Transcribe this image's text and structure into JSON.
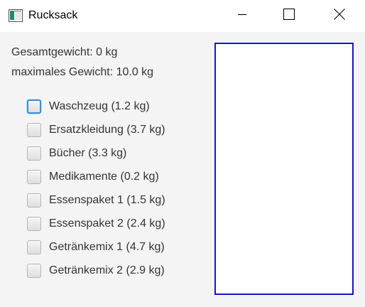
{
  "window": {
    "title": "Rucksack",
    "controls": {
      "minimize": "minimize",
      "maximize": "maximize",
      "close": "close"
    }
  },
  "info": {
    "total_weight": "Gesamtgewicht: 0 kg",
    "max_weight": "maximales Gewicht: 10.0 kg"
  },
  "items": [
    {
      "label": "Waschzeug (1.2 kg)",
      "checked": false,
      "focused": true
    },
    {
      "label": "Ersatzkleidung (3.7 kg)",
      "checked": false,
      "focused": false
    },
    {
      "label": "Bücher (3.3 kg)",
      "checked": false,
      "focused": false
    },
    {
      "label": "Medikamente (0.2 kg)",
      "checked": false,
      "focused": false
    },
    {
      "label": "Essenspaket 1 (1.5 kg)",
      "checked": false,
      "focused": false
    },
    {
      "label": "Essenspaket 2 (2.4 kg)",
      "checked": false,
      "focused": false
    },
    {
      "label": "Getränkemix 1 (4.7 kg)",
      "checked": false,
      "focused": false
    },
    {
      "label": "Getränkemix 2 (2.9 kg)",
      "checked": false,
      "focused": false
    }
  ],
  "colors": {
    "canvas_border": "#1515c8",
    "focus_ring": "#3c8ed6",
    "content_bg": "#f4f4f4"
  }
}
